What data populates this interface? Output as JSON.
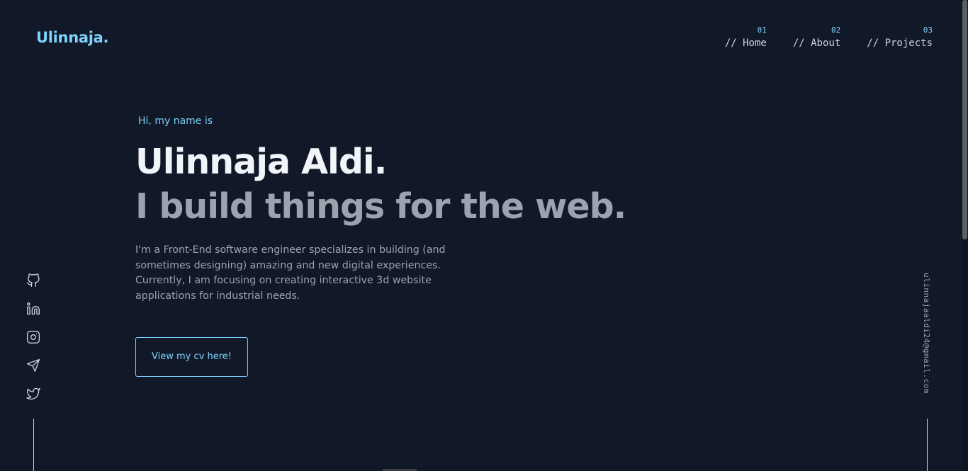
{
  "logo": "Ulinnaja.",
  "nav": [
    {
      "num": "01",
      "label": "// Home"
    },
    {
      "num": "02",
      "label": "// About"
    },
    {
      "num": "03",
      "label": "// Projects"
    }
  ],
  "hero": {
    "greeting": "Hi, my name is",
    "name": "Ulinnaja Aldi.",
    "tagline": "I build things for the web.",
    "description": "I'm a Front-End software engineer specializes in building (and sometimes designing) amazing and new digital experiences. Currently, I am focusing on creating interactive 3d website applications for industrial needs.",
    "cv_button": "View my cv here!"
  },
  "social": [
    "github-icon",
    "linkedin-icon",
    "instagram-icon",
    "telegram-icon",
    "twitter-icon"
  ],
  "email": "ulinnajaaldi24@gmail.com",
  "colors": {
    "background": "#111827",
    "accent": "#7dd3fc",
    "heading": "#f1f5f9",
    "muted": "#9ca3af"
  }
}
